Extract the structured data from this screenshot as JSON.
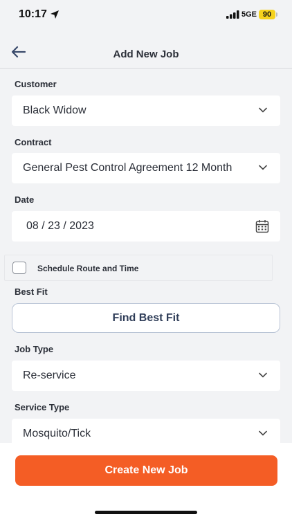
{
  "status_bar": {
    "time": "10:17",
    "network": "5GE",
    "battery": "90"
  },
  "nav": {
    "title": "Add New Job"
  },
  "form": {
    "customer": {
      "label": "Customer",
      "value": "Black Widow"
    },
    "contract": {
      "label": "Contract",
      "value": "General Pest Control Agreement 12 Month"
    },
    "date": {
      "label": "Date",
      "value": "08 / 23 / 2023"
    },
    "schedule": {
      "label": "Schedule Route and Time",
      "checked": false
    },
    "best_fit": {
      "label": "Best Fit",
      "button": "Find Best Fit"
    },
    "job_type": {
      "label": "Job Type",
      "value": "Re-service"
    },
    "service_type": {
      "label": "Service Type",
      "value": "Mosquito/Tick"
    }
  },
  "footer": {
    "create_button": "Create New Job"
  },
  "colors": {
    "accent": "#f45d25",
    "background": "#f2f3f5",
    "text": "#2b2f38"
  }
}
